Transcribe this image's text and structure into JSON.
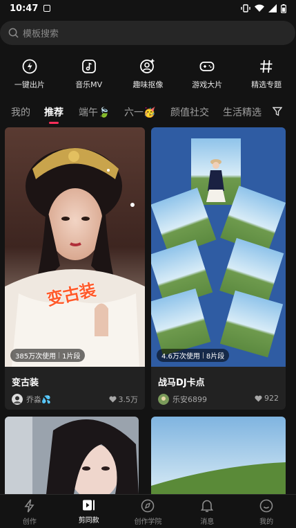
{
  "status": {
    "time": "10:47"
  },
  "search": {
    "placeholder": "模板搜索"
  },
  "quick": [
    {
      "label": "一键出片",
      "icon": "lightning-circle-icon"
    },
    {
      "label": "音乐MV",
      "icon": "music-note-icon"
    },
    {
      "label": "趣味抠像",
      "icon": "person-sparkle-icon"
    },
    {
      "label": "游戏大片",
      "icon": "gamepad-icon"
    },
    {
      "label": "精选专题",
      "icon": "hashtag-icon"
    }
  ],
  "tabs": [
    {
      "label": "我的"
    },
    {
      "label": "推荐",
      "active": true
    },
    {
      "label": "端午🍃"
    },
    {
      "label": "六一🥳"
    },
    {
      "label": "颜值社交"
    },
    {
      "label": "生活精选"
    }
  ],
  "cards": [
    {
      "title": "变古装",
      "author": "乔淼💦",
      "likes": "3.5万",
      "uses": "385万次使用",
      "segments": "1片段",
      "overlay_text": "变古装"
    },
    {
      "title": "战马DJ卡点",
      "author": "乐安6899",
      "likes": "922",
      "uses": "4.6万次使用",
      "segments": "8片段"
    }
  ],
  "nav": [
    {
      "label": "创作",
      "icon": "lightning-icon"
    },
    {
      "label": "剪同款",
      "icon": "template-play-icon",
      "active": true
    },
    {
      "label": "创作学院",
      "icon": "compass-icon"
    },
    {
      "label": "消息",
      "icon": "bell-icon"
    },
    {
      "label": "我的",
      "icon": "smile-icon"
    }
  ]
}
